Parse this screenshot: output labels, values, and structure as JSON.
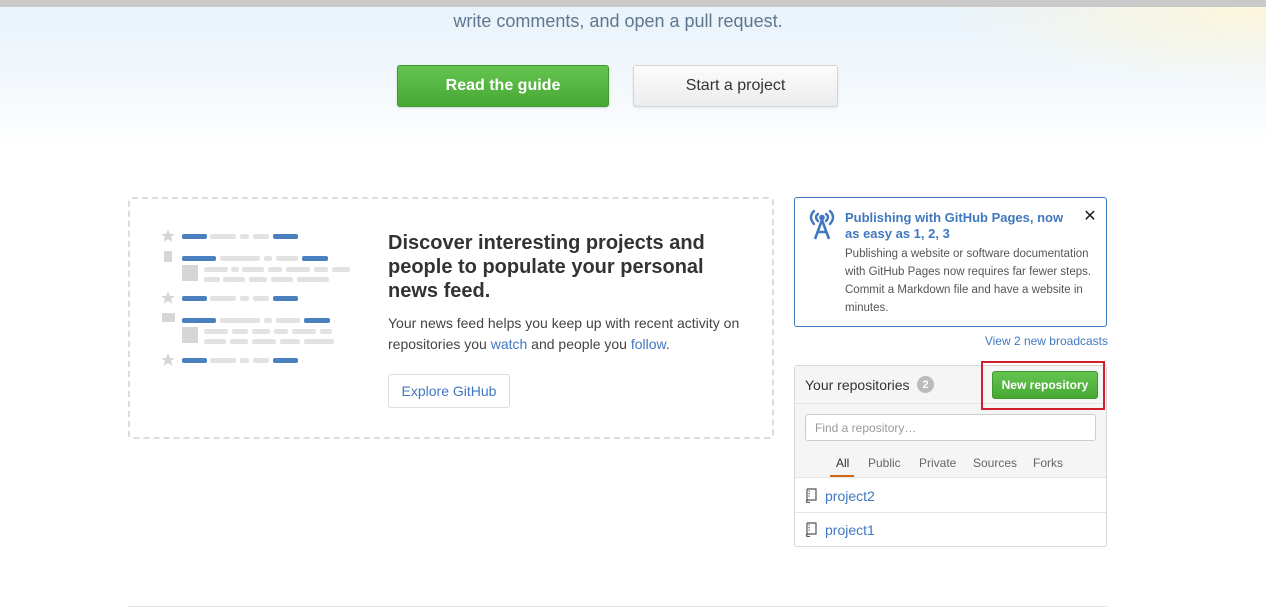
{
  "hero": {
    "text": "write comments, and open a pull request.",
    "read_guide_label": "Read the guide",
    "start_project_label": "Start a project"
  },
  "feed": {
    "title": "Discover interesting projects and people to populate your personal news feed.",
    "desc_part1": "Your news feed helps you keep up with recent activity on repositories you ",
    "watch_link": "watch",
    "desc_part2": " and people you ",
    "follow_link": "follow",
    "desc_part3": ".",
    "explore_label": "Explore GitHub"
  },
  "broadcast": {
    "icon": "broadcast-icon",
    "title": "Publishing with GitHub Pages, now as easy as 1, 2, 3",
    "body": "Publishing a website or software documentation with GitHub Pages now requires far fewer steps. Commit a Markdown file and have a website in minutes.",
    "close": "✕",
    "view_more": "View 2 new broadcasts"
  },
  "repos": {
    "title": "Your repositories",
    "count": "2",
    "new_label": "New repository",
    "search_placeholder": "Find a repository…",
    "tabs": [
      "All",
      "Public",
      "Private",
      "Sources",
      "Forks"
    ],
    "items": [
      {
        "name": "project2"
      },
      {
        "name": "project1"
      }
    ]
  },
  "colors": {
    "link": "#4078c0",
    "green": "#55b940",
    "highlight": "#d0202b",
    "tab_active": "#d26911"
  }
}
